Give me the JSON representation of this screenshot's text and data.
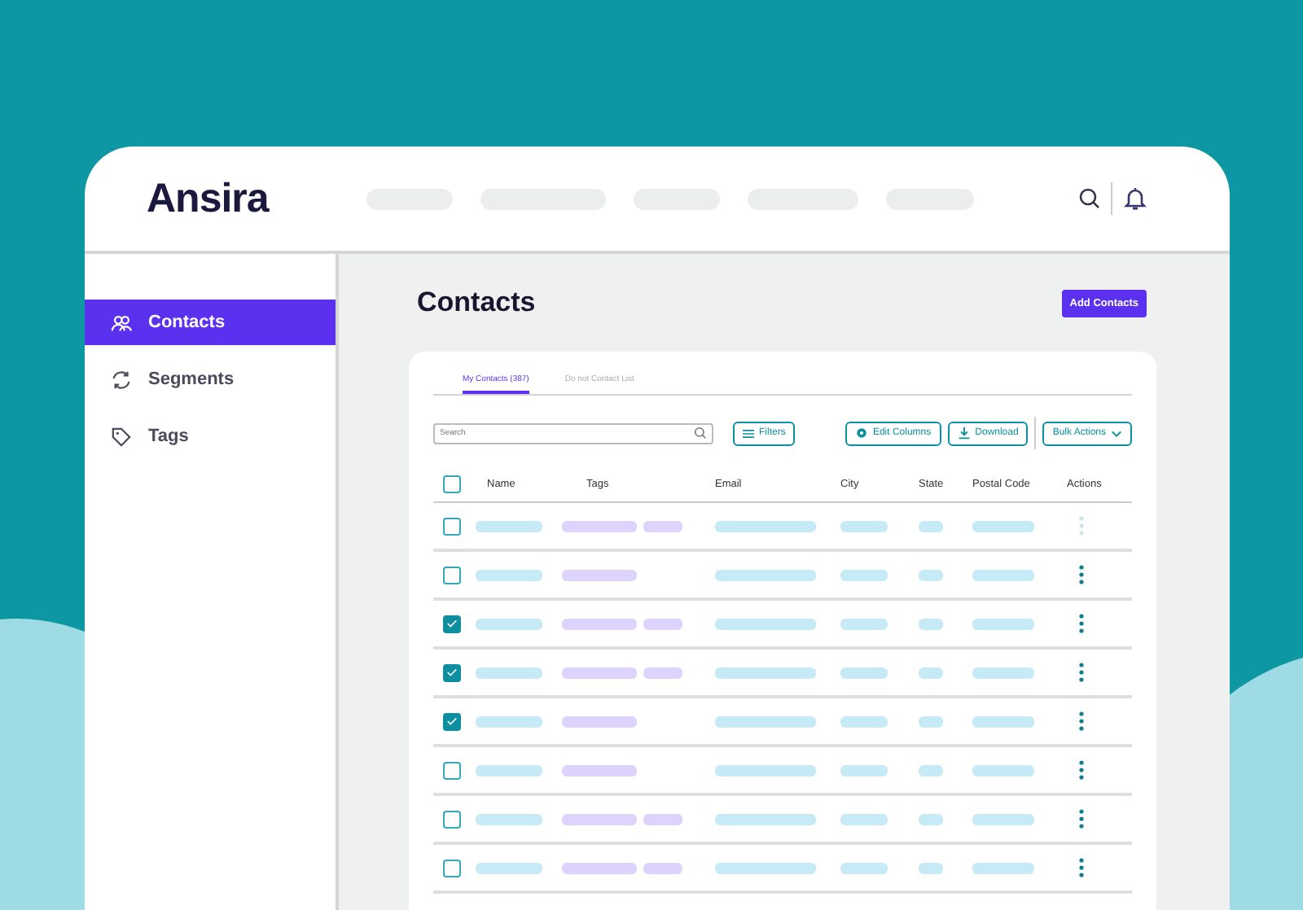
{
  "header": {
    "logo": "Ansira"
  },
  "sidebar": {
    "items": [
      {
        "label": "Contacts",
        "kind": "people",
        "selected": true
      },
      {
        "label": "Segments",
        "kind": "cycle",
        "selected": false
      },
      {
        "label": "Tags",
        "kind": "tag",
        "selected": false
      }
    ]
  },
  "page": {
    "title": "Contacts",
    "add_button": "Add Contacts"
  },
  "tabs": [
    {
      "label": "My Contacts (387)",
      "selected": true
    },
    {
      "label": "Do not Contact List",
      "selected": false
    }
  ],
  "toolbar": {
    "search": {
      "placeholder": "Search"
    },
    "filters": "Filters",
    "edit_columns": "Edit Columns",
    "download": "Download",
    "bulk_actions": "Bulk Actions"
  },
  "table": {
    "select_all": {
      "checked": false
    },
    "columns": [
      "Name",
      "Tags",
      "Email",
      "City",
      "State",
      "Postal Code",
      "Actions"
    ],
    "rows": [
      {
        "checked": false,
        "kind": "two-tags",
        "actions_disabled": true
      },
      {
        "checked": false,
        "kind": "one-tag",
        "actions_disabled": false
      },
      {
        "checked": true,
        "kind": "two-tags",
        "actions_disabled": false
      },
      {
        "checked": true,
        "kind": "two-tags",
        "actions_disabled": false
      },
      {
        "checked": true,
        "kind": "one-tag",
        "actions_disabled": false
      },
      {
        "checked": false,
        "kind": "one-tag",
        "actions_disabled": false
      },
      {
        "checked": false,
        "kind": "two-tags",
        "actions_disabled": false
      },
      {
        "checked": false,
        "kind": "two-tags",
        "actions_disabled": false
      }
    ]
  }
}
